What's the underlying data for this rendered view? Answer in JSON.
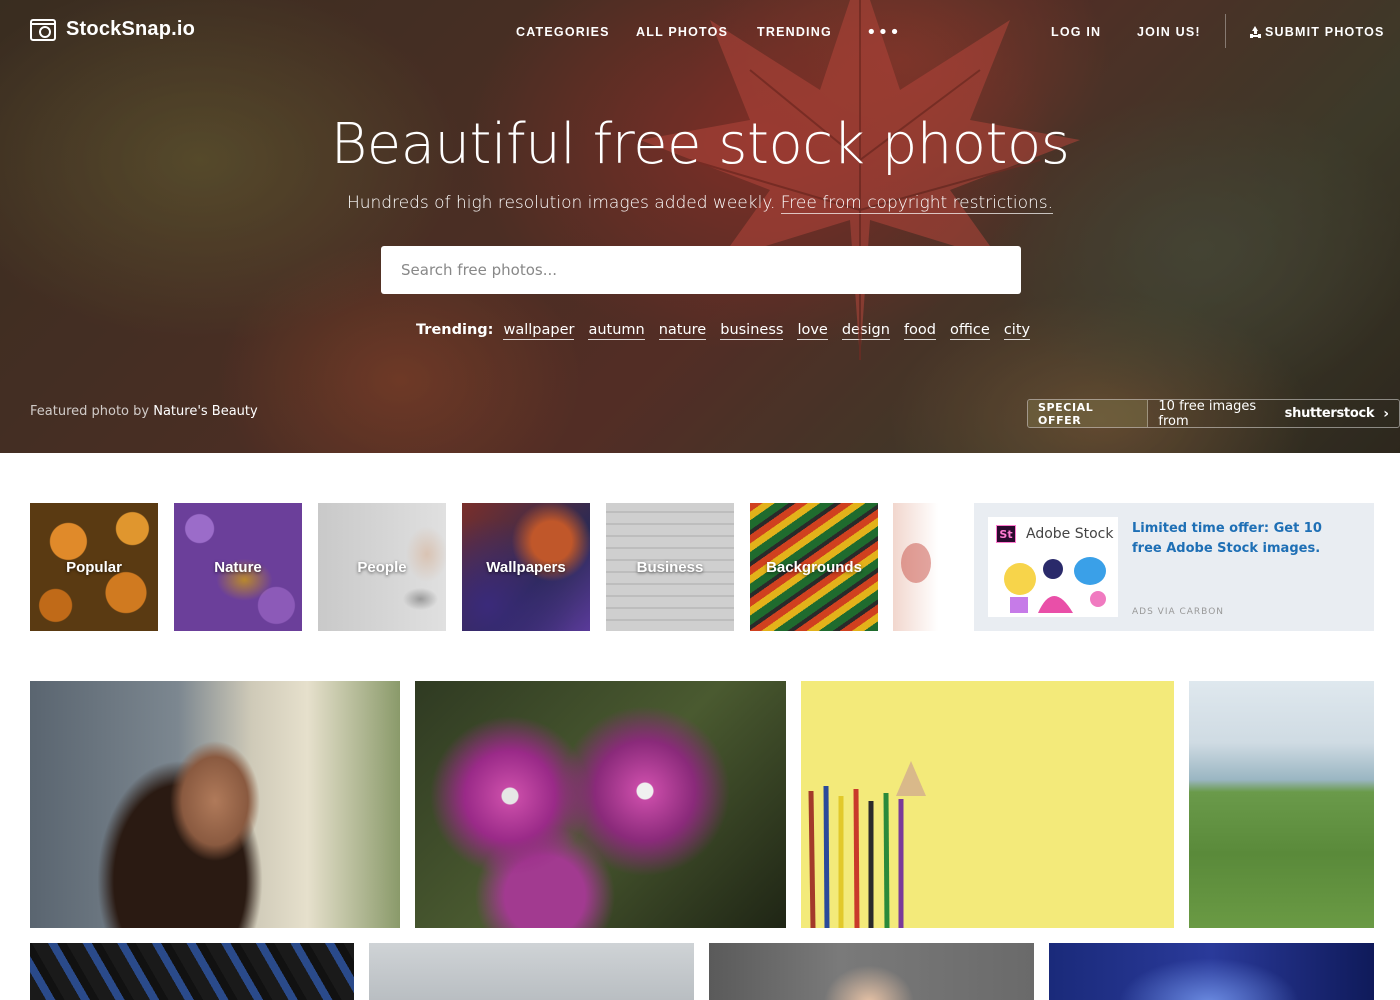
{
  "brand": {
    "name": "StockSnap.io"
  },
  "nav": {
    "categories": "CATEGORIES",
    "all_photos": "ALL PHOTOS",
    "trending": "TRENDING",
    "more": "•••",
    "login": "LOG IN",
    "join": "JOIN US!",
    "submit": "SUBMIT PHOTOS"
  },
  "hero": {
    "title": "Beautiful free stock photos",
    "subtitle": "Hundreds of high resolution images added weekly.",
    "subtitle_link": "Free from copyright restrictions.",
    "search_placeholder": "Search free photos...",
    "trending_label": "Trending:",
    "trending_tags": [
      "wallpaper",
      "autumn",
      "nature",
      "business",
      "love",
      "design",
      "food",
      "office",
      "city"
    ],
    "featured_prefix": "Featured photo by",
    "featured_author": "Nature's Beauty"
  },
  "offer": {
    "badge": "SPECIAL OFFER",
    "text": "10 free images from",
    "brand": "shutterstock"
  },
  "categories": [
    "Popular",
    "Nature",
    "People",
    "Wallpapers",
    "Business",
    "Backgrounds"
  ],
  "ad": {
    "logo_mark": "St",
    "logo_text": "Adobe Stock",
    "copy": "Limited time offer: Get 10 free Adobe Stock images.",
    "via": "ADS VIA CARBON"
  },
  "icons": {
    "logo": "camera-icon",
    "search": "search-icon",
    "submit": "upload-icon",
    "offer_arrow": "chevron-right-icon"
  }
}
